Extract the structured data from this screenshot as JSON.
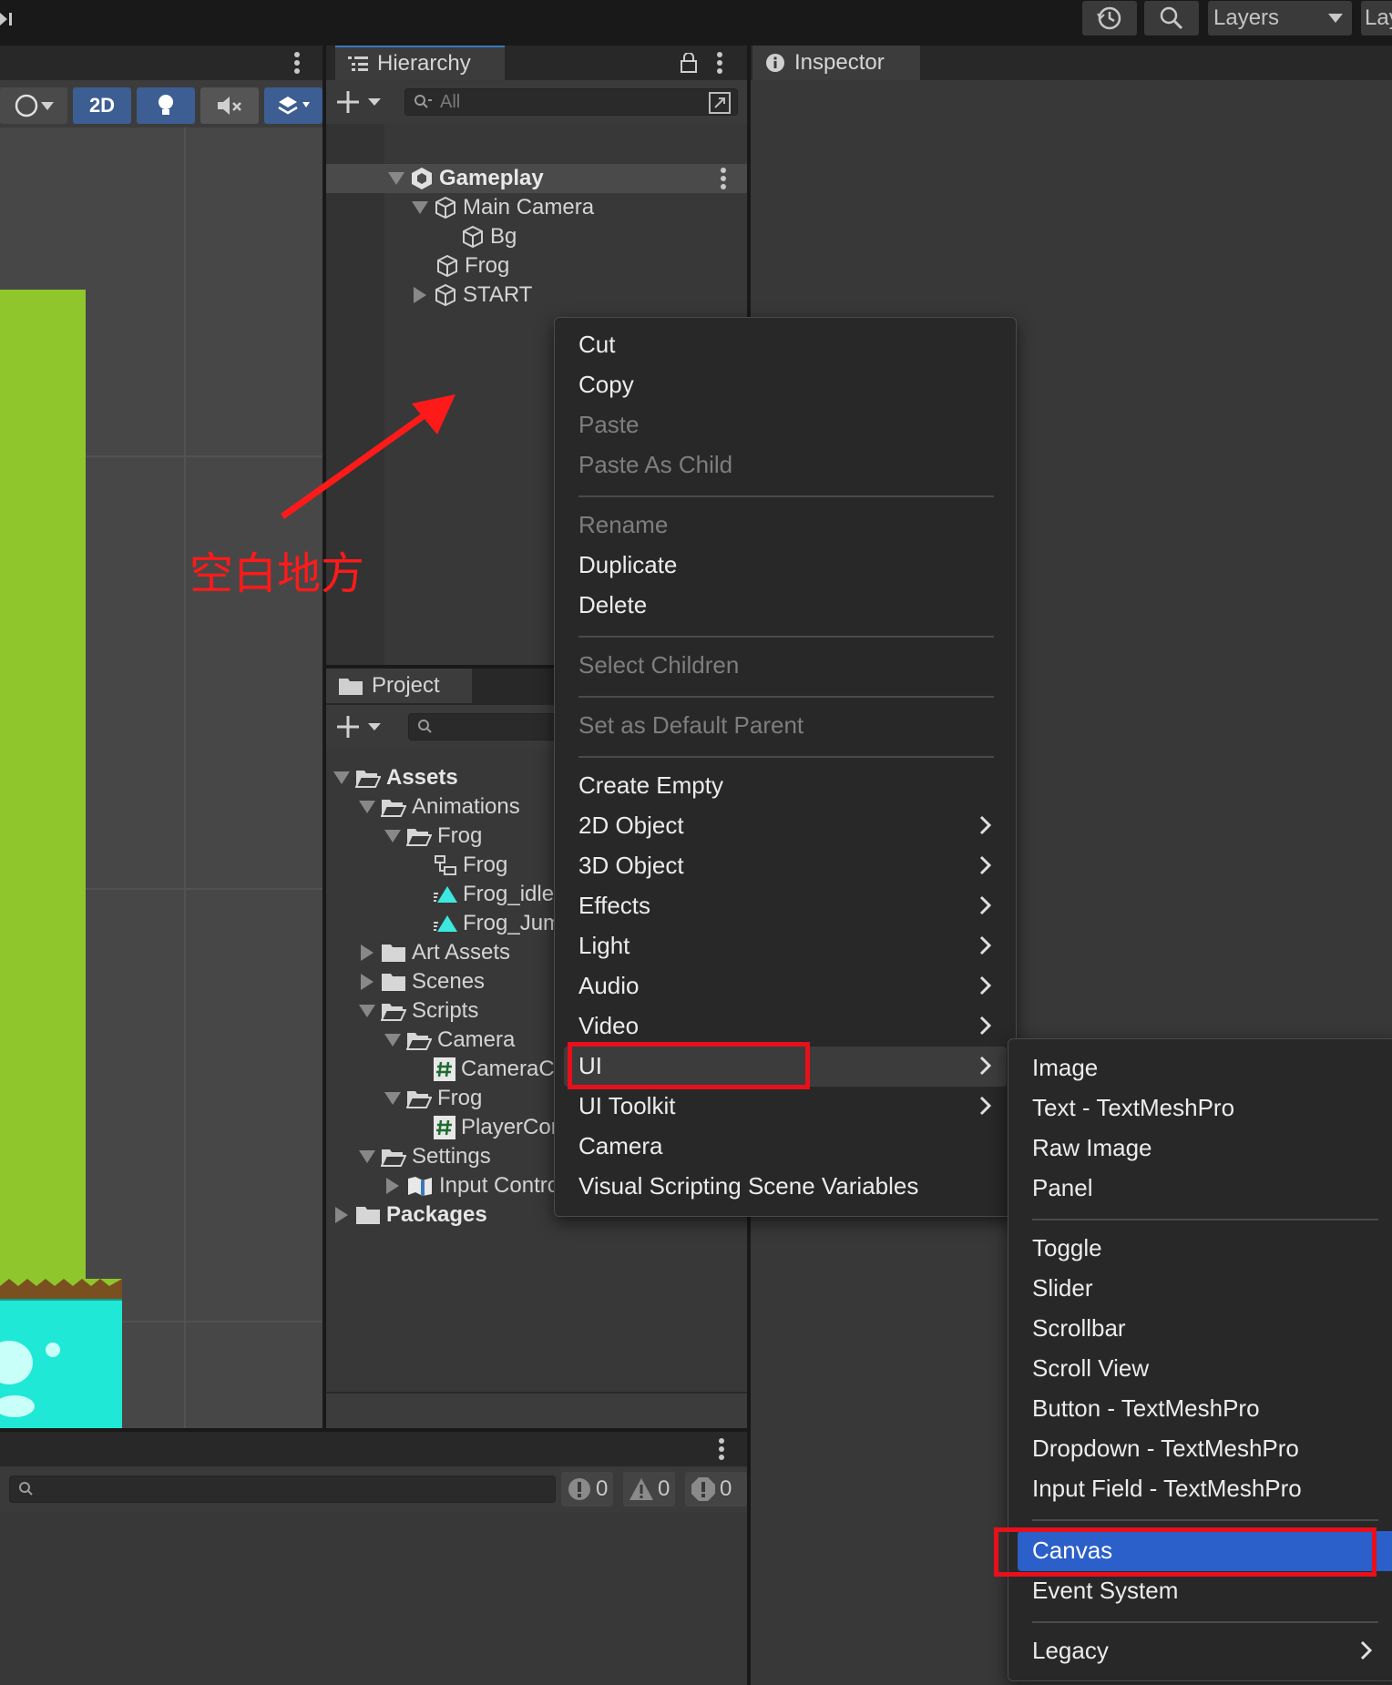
{
  "toolbar": {
    "layers_label": "Layers",
    "layout_label": "Layout"
  },
  "scene": {
    "mode_2d_label": "2D"
  },
  "hierarchy": {
    "tab_label": "Hierarchy",
    "search_placeholder": "All",
    "scene_name": "Gameplay",
    "items": [
      "Main Camera",
      "Bg",
      "Frog",
      "START"
    ]
  },
  "project": {
    "tab_label": "Project",
    "tree": {
      "assets": "Assets",
      "animations": "Animations",
      "frog_folder": "Frog",
      "frog_controller": "Frog",
      "frog_idle": "Frog_idle",
      "frog_jump": "Frog_Jump",
      "art_assets": "Art Assets",
      "scenes": "Scenes",
      "scripts": "Scripts",
      "camera_folder": "Camera",
      "camera_script": "CameraController",
      "frog_scripts_folder": "Frog",
      "player_script": "PlayerController",
      "settings": "Settings",
      "input_controls": "Input Controls",
      "packages": "Packages"
    }
  },
  "console": {
    "log_count": "0",
    "warning_count": "0",
    "error_count": "0"
  },
  "inspector": {
    "tab_label": "Inspector"
  },
  "annotation": {
    "text": "空白地方",
    "color": "#ff1a1a"
  },
  "context_menu": {
    "cut": "Cut",
    "copy": "Copy",
    "paste": "Paste",
    "paste_as_child": "Paste As Child",
    "rename": "Rename",
    "duplicate": "Duplicate",
    "delete": "Delete",
    "select_children": "Select Children",
    "set_default_parent": "Set as Default Parent",
    "create_empty": "Create Empty",
    "object_2d": "2D Object",
    "object_3d": "3D Object",
    "effects": "Effects",
    "light": "Light",
    "audio": "Audio",
    "video": "Video",
    "ui": "UI",
    "ui_toolkit": "UI Toolkit",
    "camera": "Camera",
    "visual_scripting": "Visual Scripting Scene Variables"
  },
  "ui_submenu": {
    "image": "Image",
    "text_tmp": "Text - TextMeshPro",
    "raw_image": "Raw Image",
    "panel": "Panel",
    "toggle": "Toggle",
    "slider": "Slider",
    "scrollbar": "Scrollbar",
    "scroll_view": "Scroll View",
    "button_tmp": "Button - TextMeshPro",
    "dropdown_tmp": "Dropdown - TextMeshPro",
    "input_field_tmp": "Input Field - TextMeshPro",
    "canvas": "Canvas",
    "event_system": "Event System",
    "legacy": "Legacy"
  },
  "colors": {
    "highlight_box": "#e8101a",
    "selected_item": "#2b5fc9",
    "grass": "#8fc62c",
    "water": "#1fe8d6"
  }
}
